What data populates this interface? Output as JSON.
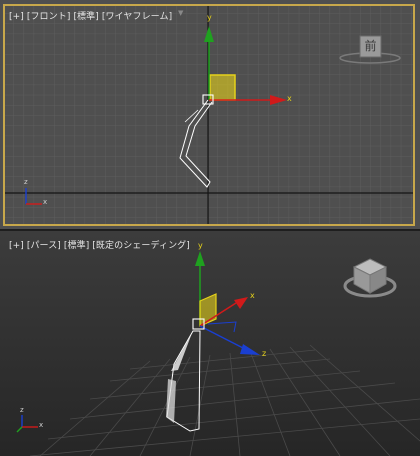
{
  "viewport_front": {
    "menu": "[+]",
    "view": "[フロント]",
    "quality": "[標準]",
    "shading": "[ワイヤフレーム]",
    "viewcube_face": "前"
  },
  "viewport_persp": {
    "menu": "[+]",
    "view": "[パース]",
    "quality": "[標準]",
    "shading": "[既定のシェーディング]"
  },
  "gizmo": {
    "x": "x",
    "y": "y",
    "z": "z"
  },
  "colors": {
    "active_border": "#c8a84b",
    "x_axis": "#d11a1a",
    "y_axis": "#1fa11f",
    "z_axis": "#1a3fd1",
    "plane_handle": "#e6d21a"
  }
}
